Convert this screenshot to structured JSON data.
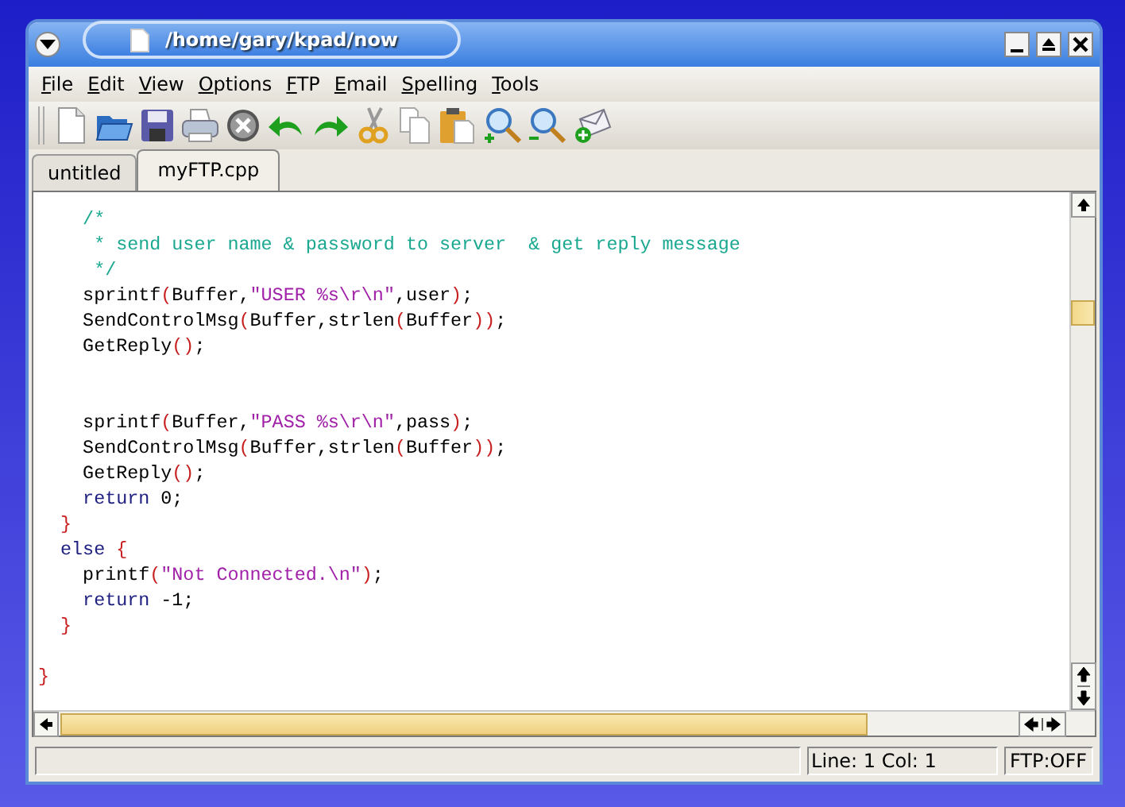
{
  "window": {
    "title": "/home/gary/kpad/now"
  },
  "menu": [
    "File",
    "Edit",
    "View",
    "Options",
    "FTP",
    "Email",
    "Spelling",
    "Tools"
  ],
  "tabs": [
    {
      "label": "untitled",
      "selected": false
    },
    {
      "label": "myFTP.cpp",
      "selected": true
    }
  ],
  "editor": {
    "lines": [
      {
        "kind": "code",
        "tokens": [
          {
            "kind": "comment",
            "text": "    /*"
          }
        ]
      },
      {
        "kind": "code",
        "tokens": [
          {
            "kind": "comment",
            "text": "     * send user name & password to server  & get reply message"
          }
        ]
      },
      {
        "kind": "code",
        "tokens": [
          {
            "kind": "comment",
            "text": "     */"
          }
        ]
      },
      {
        "kind": "code",
        "tokens": [
          {
            "kind": "plain",
            "text": "    sprintf"
          },
          {
            "kind": "punct",
            "text": "("
          },
          {
            "kind": "plain",
            "text": "Buffer,"
          },
          {
            "kind": "string",
            "text": "\"USER %s\\r\\n\""
          },
          {
            "kind": "plain",
            "text": ",user"
          },
          {
            "kind": "punct",
            "text": ")"
          },
          {
            "kind": "plain",
            "text": ";"
          }
        ]
      },
      {
        "kind": "code",
        "tokens": [
          {
            "kind": "plain",
            "text": "    SendControlMsg"
          },
          {
            "kind": "punct",
            "text": "("
          },
          {
            "kind": "plain",
            "text": "Buffer,strlen"
          },
          {
            "kind": "punct",
            "text": "("
          },
          {
            "kind": "plain",
            "text": "Buffer"
          },
          {
            "kind": "punct",
            "text": "))"
          },
          {
            "kind": "plain",
            "text": ";"
          }
        ]
      },
      {
        "kind": "code",
        "tokens": [
          {
            "kind": "plain",
            "text": "    GetReply"
          },
          {
            "kind": "punct",
            "text": "()"
          },
          {
            "kind": "plain",
            "text": ";"
          }
        ]
      },
      {
        "kind": "blank"
      },
      {
        "kind": "blank"
      },
      {
        "kind": "code",
        "tokens": [
          {
            "kind": "plain",
            "text": "    sprintf"
          },
          {
            "kind": "punct",
            "text": "("
          },
          {
            "kind": "plain",
            "text": "Buffer,"
          },
          {
            "kind": "string",
            "text": "\"PASS %s\\r\\n\""
          },
          {
            "kind": "plain",
            "text": ",pass"
          },
          {
            "kind": "punct",
            "text": ")"
          },
          {
            "kind": "plain",
            "text": ";"
          }
        ]
      },
      {
        "kind": "code",
        "tokens": [
          {
            "kind": "plain",
            "text": "    SendControlMsg"
          },
          {
            "kind": "punct",
            "text": "("
          },
          {
            "kind": "plain",
            "text": "Buffer,strlen"
          },
          {
            "kind": "punct",
            "text": "("
          },
          {
            "kind": "plain",
            "text": "Buffer"
          },
          {
            "kind": "punct",
            "text": "))"
          },
          {
            "kind": "plain",
            "text": ";"
          }
        ]
      },
      {
        "kind": "code",
        "tokens": [
          {
            "kind": "plain",
            "text": "    GetReply"
          },
          {
            "kind": "punct",
            "text": "()"
          },
          {
            "kind": "plain",
            "text": ";"
          }
        ]
      },
      {
        "kind": "code",
        "tokens": [
          {
            "kind": "keyword",
            "text": "    return"
          },
          {
            "kind": "plain",
            "text": " 0;"
          }
        ]
      },
      {
        "kind": "code",
        "tokens": [
          {
            "kind": "punct",
            "text": "  }"
          }
        ]
      },
      {
        "kind": "code",
        "tokens": [
          {
            "kind": "keyword",
            "text": "  else"
          },
          {
            "kind": "punct",
            "text": " {"
          }
        ]
      },
      {
        "kind": "code",
        "tokens": [
          {
            "kind": "plain",
            "text": "    printf"
          },
          {
            "kind": "punct",
            "text": "("
          },
          {
            "kind": "string",
            "text": "\"Not Connected.\\n\""
          },
          {
            "kind": "punct",
            "text": ")"
          },
          {
            "kind": "plain",
            "text": ";"
          }
        ]
      },
      {
        "kind": "code",
        "tokens": [
          {
            "kind": "keyword",
            "text": "    return"
          },
          {
            "kind": "plain",
            "text": " -1;"
          }
        ]
      },
      {
        "kind": "code",
        "tokens": [
          {
            "kind": "punct",
            "text": "  }"
          }
        ]
      },
      {
        "kind": "blank"
      },
      {
        "kind": "code",
        "tokens": [
          {
            "kind": "punct",
            "text": "}"
          }
        ]
      }
    ]
  },
  "status_bar": {
    "position": "Line: 1 Col: 1",
    "ftp": "FTP:OFF"
  }
}
